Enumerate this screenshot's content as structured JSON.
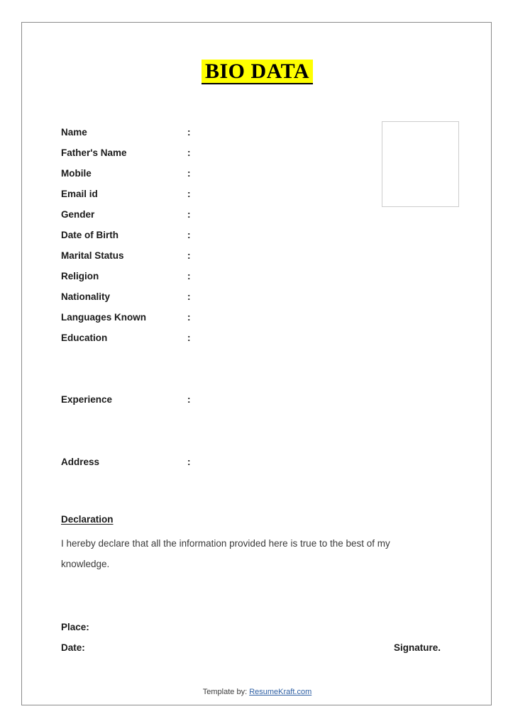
{
  "document": {
    "title": "BIO DATA",
    "title_highlight_color": "#ffff00",
    "border_color": "#8a8a8a",
    "photo_box": {
      "label": "photo-placeholder",
      "border_color": "#cccccc"
    }
  },
  "fields": [
    {
      "label": "Name",
      "colon": ":",
      "value": ""
    },
    {
      "label": "Father's Name",
      "colon": ":",
      "value": ""
    },
    {
      "label": "Mobile",
      "colon": ":",
      "value": ""
    },
    {
      "label": "Email id",
      "colon": ":",
      "value": ""
    },
    {
      "label": "Gender",
      "colon": ":",
      "value": ""
    },
    {
      "label": "Date of Birth",
      "colon": ":",
      "value": ""
    },
    {
      "label": "Marital Status",
      "colon": ":",
      "value": ""
    },
    {
      "label": "Religion",
      "colon": ":",
      "value": ""
    },
    {
      "label": "Nationality",
      "colon": ":",
      "value": ""
    },
    {
      "label": "Languages Known",
      "colon": ":",
      "value": ""
    },
    {
      "label": "Education",
      "colon": ":",
      "value": ""
    },
    {
      "label": "Experience",
      "colon": ":",
      "value": ""
    },
    {
      "label": "Address",
      "colon": ":",
      "value": ""
    }
  ],
  "declaration": {
    "heading": "Declaration",
    "body": "I hereby declare that all the information provided here is true to the best of my knowledge."
  },
  "signoff": {
    "place_label": "Place:",
    "place_value": "",
    "date_label": "Date:",
    "date_value": "",
    "signature_label": "Signature."
  },
  "footer": {
    "prefix": "Template by:",
    "link_text": "ResumeKraft.com",
    "link_color": "#2e5fa3"
  }
}
